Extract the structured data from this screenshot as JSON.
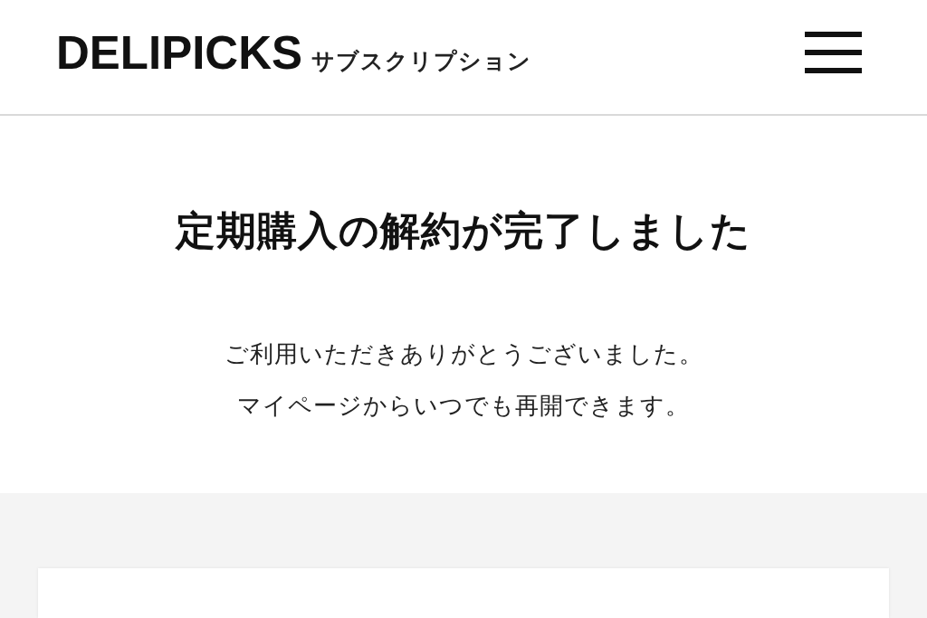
{
  "header": {
    "logo": "DELIPICKS",
    "subtitle": "サブスクリプション"
  },
  "main": {
    "title": "定期購入の解約が完了しました",
    "message_lines": [
      "ご利用いただきありがとうございました。",
      "マイページからいつでも再開できます。"
    ]
  }
}
